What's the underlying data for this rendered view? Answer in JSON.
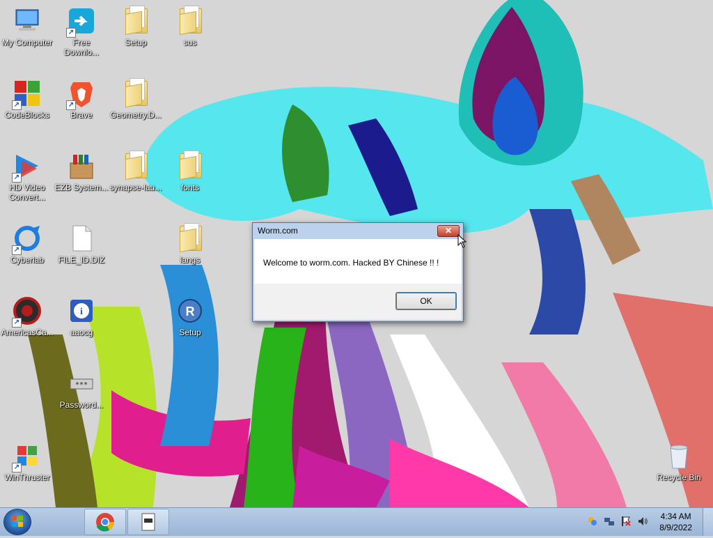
{
  "desktop": {
    "icons": [
      {
        "label": "My Computer",
        "icon": "computer-icon"
      },
      {
        "label": "Free Downlo...",
        "icon": "download-icon"
      },
      {
        "label": "Setup",
        "icon": "folder-icon"
      },
      {
        "label": "sus",
        "icon": "folder-icon"
      },
      {
        "label": "CodeBlocks",
        "icon": "codeblocks-icon"
      },
      {
        "label": "Brave",
        "icon": "brave-icon"
      },
      {
        "label": "Geometry.D...",
        "icon": "folder-icon"
      },
      {
        "label": "HD Video Convert...",
        "icon": "video-convert-icon"
      },
      {
        "label": "EZB System...",
        "icon": "installer-box-icon"
      },
      {
        "label": "synapse-lau...",
        "icon": "folder-icon"
      },
      {
        "label": "fonts",
        "icon": "folder-icon"
      },
      {
        "label": "Cyberlab",
        "icon": "cyberlab-icon"
      },
      {
        "label": "FILE_ID.DIZ",
        "icon": "file-icon"
      },
      {
        "label": "langs",
        "icon": "folder-icon"
      },
      {
        "label": "AmericasCa...",
        "icon": "casino-chip-icon"
      },
      {
        "label": "aaocg",
        "icon": "info-icon"
      },
      {
        "label": "Setup",
        "icon": "setup-r-icon"
      },
      {
        "label": "Password...",
        "icon": "password-icon"
      },
      {
        "label": "WinThruster",
        "icon": "winthruster-icon"
      },
      {
        "label": "Recycle Bin",
        "icon": "recycle-bin-icon"
      }
    ]
  },
  "dialog": {
    "title": "Worm.com",
    "message": "Welcome to worm.com. Hacked BY Chinese !! !",
    "ok_label": "OK",
    "close_icon": "close-icon"
  },
  "taskbar": {
    "start_icon": "windows-logo-icon",
    "pinned": [
      {
        "icon": "chrome-icon"
      },
      {
        "icon": "app-window-icon"
      }
    ],
    "tray": {
      "icons": [
        "network-agent-icon",
        "network-icon",
        "action-center-icon",
        "volume-icon"
      ],
      "time": "4:34 AM",
      "date": "8/9/2022"
    }
  },
  "colors": {
    "taskbar": "#a9c0de",
    "dialog_frame": "#bcd2ec",
    "close_button": "#c4402a"
  }
}
